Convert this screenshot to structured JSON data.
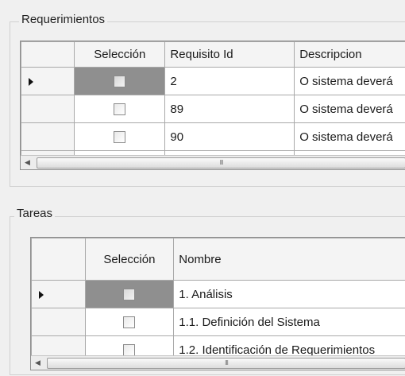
{
  "requerimientos": {
    "title": "Requerimientos",
    "columns": [
      "Selección",
      "Requisito Id",
      "Descripcion"
    ],
    "rows": [
      {
        "id": "2",
        "desc": "O sistema deverá",
        "checked": false,
        "current": true
      },
      {
        "id": "89",
        "desc": "O sistema deverá",
        "checked": false,
        "current": false
      },
      {
        "id": "90",
        "desc": "O sistema deverá",
        "checked": false,
        "current": false
      }
    ],
    "scrollbar_grip": "III"
  },
  "tareas": {
    "title": "Tareas",
    "columns": [
      "Selección",
      "Nombre"
    ],
    "rows": [
      {
        "name": "1. Análisis",
        "checked": false,
        "current": true
      },
      {
        "name": "1.1. Definición del Sistema",
        "checked": false,
        "current": false
      },
      {
        "name": "1.2. Identificación de Requerimientos",
        "checked": false,
        "current": false
      }
    ],
    "scrollbar_grip": "III"
  },
  "icons": {
    "row_pointer": "current-row-arrow-icon",
    "scroll_left": "chevron-left-icon"
  },
  "colors": {
    "window_bg": "#f0f0f0",
    "grid_line": "#a9a9a9",
    "selected_cell": "#8f8f8f"
  }
}
